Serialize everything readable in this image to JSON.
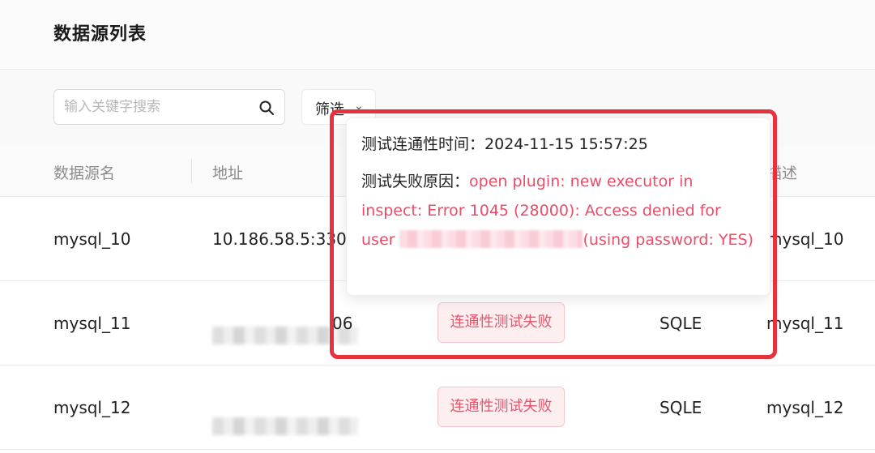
{
  "page": {
    "title": "数据源列表"
  },
  "toolbar": {
    "search": {
      "placeholder": "输入关键字搜索",
      "value": "",
      "icon": "search-icon"
    },
    "filter": {
      "label": "筛选",
      "icon": "chevron-down-icon"
    }
  },
  "table": {
    "columns": {
      "name": "数据源名",
      "address": "地址",
      "description": "描述"
    },
    "rows": [
      {
        "name": "mysql_10",
        "address": "10.186.58.5:330",
        "address_partial": "",
        "status": "",
        "type": "",
        "description": "mysql_10"
      },
      {
        "name": "mysql_11",
        "address_partial": "06",
        "status": "连通性测试失败",
        "type": "SQLE",
        "description": "mysql_11"
      },
      {
        "name": "mysql_12",
        "address_partial": "",
        "status": "连通性测试失败",
        "type": "SQLE",
        "description": "mysql_12"
      }
    ]
  },
  "popover": {
    "time_label": "测试连通性时间：",
    "time_value": "2024-11-15 15:57:25",
    "reason_label": "测试失败原因：",
    "reason_part1": "open plugin: new executor in inspect: Error 1045 (28000): Access denied for user ",
    "reason_part2": "(using password: YES)"
  },
  "colors": {
    "accent_red": "#e5323d",
    "error_text": "#ea4d68",
    "badge_bg": "#fdeef0"
  }
}
